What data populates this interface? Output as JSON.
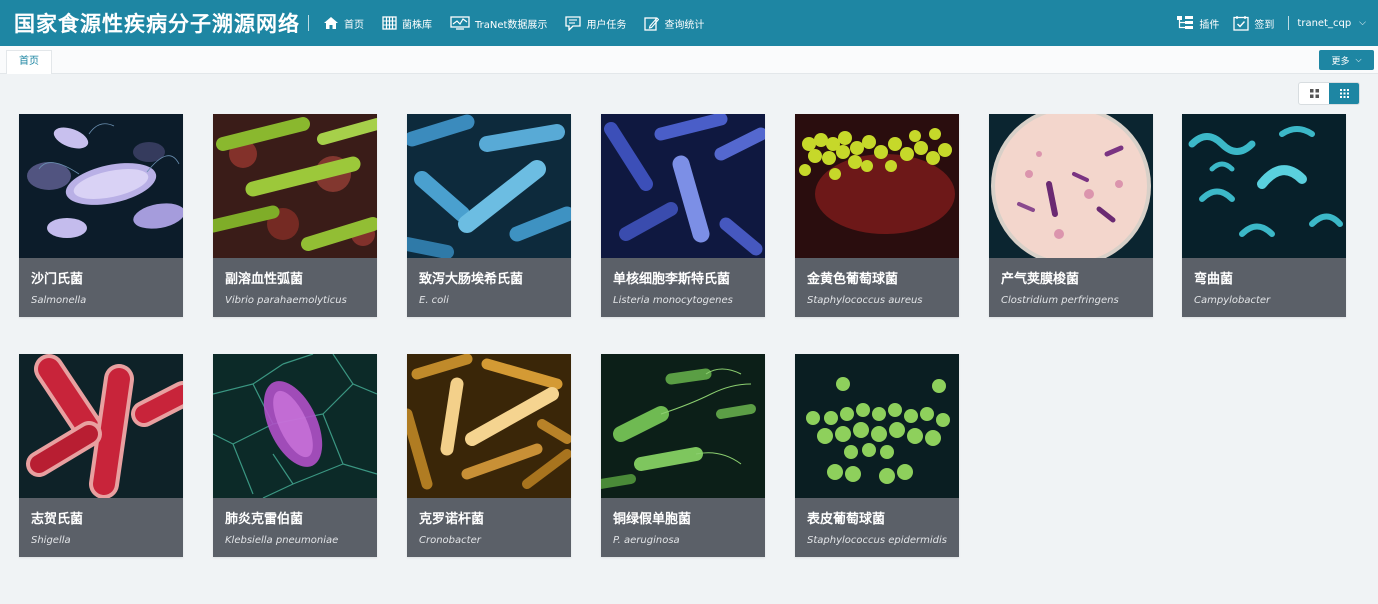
{
  "header": {
    "title": "国家食源性疾病分子溯源网络",
    "nav": [
      {
        "label": "首页",
        "icon": "home-icon"
      },
      {
        "label": "菌株库",
        "icon": "strain-library-icon"
      },
      {
        "label": "TraNet数据展示",
        "icon": "chart-monitor-icon"
      },
      {
        "label": "用户任务",
        "icon": "task-icon"
      },
      {
        "label": "查询统计",
        "icon": "query-stats-icon"
      }
    ],
    "plugins_label": "插件",
    "checkin_label": "签到",
    "username": "tranet_cqp"
  },
  "tabs": {
    "items": [
      {
        "label": "首页"
      }
    ],
    "more_label": "更多"
  },
  "colors": {
    "primary": "#1e86a3",
    "caption_bg": "#5b6068",
    "page_bg": "#f0f3f5"
  },
  "bacteria": [
    {
      "name_cn": "沙门氏菌",
      "name_latin": "Salmonella"
    },
    {
      "name_cn": "副溶血性弧菌",
      "name_latin": "Vibrio parahaemolyticus"
    },
    {
      "name_cn": "致泻大肠埃希氏菌",
      "name_latin": "E. coli"
    },
    {
      "name_cn": "单核细胞李斯特氏菌",
      "name_latin": "Listeria monocytogenes"
    },
    {
      "name_cn": "金黄色葡萄球菌",
      "name_latin": "Staphylococcus aureus"
    },
    {
      "name_cn": "产气荚膜梭菌",
      "name_latin": "Clostridium perfringens"
    },
    {
      "name_cn": "弯曲菌",
      "name_latin": "Campylobacter"
    },
    {
      "name_cn": "志贺氏菌",
      "name_latin": "Shigella"
    },
    {
      "name_cn": "肺炎克雷伯菌",
      "name_latin": "Klebsiella pneumoniae"
    },
    {
      "name_cn": "克罗诺杆菌",
      "name_latin": "Cronobacter"
    },
    {
      "name_cn": "铜绿假单胞菌",
      "name_latin": "P. aeruginosa"
    },
    {
      "name_cn": "表皮葡萄球菌",
      "name_latin": "Staphylococcus epidermidis"
    }
  ]
}
